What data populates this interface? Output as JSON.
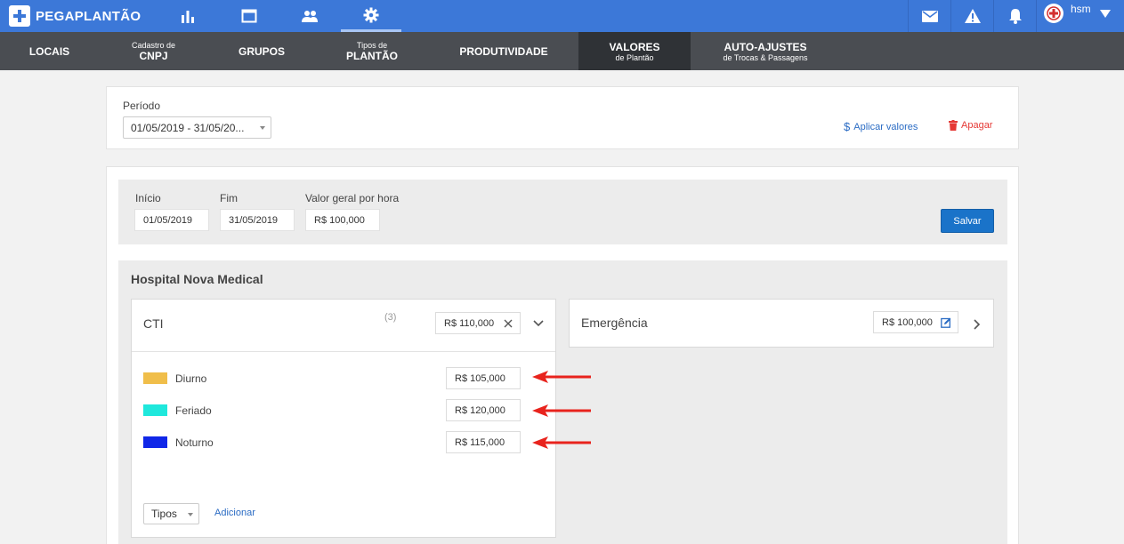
{
  "app": {
    "name": "PEGAPLANTÃO"
  },
  "top_nav": {
    "icons": [
      "bar-chart-icon",
      "window-icon",
      "people-icon",
      "gear-icon"
    ],
    "active": "gear-icon"
  },
  "top_right": {
    "icons": [
      "mail-icon",
      "warning-icon",
      "bell-icon"
    ],
    "user": "hsm"
  },
  "sub_nav": [
    {
      "small": "",
      "main": "LOCAIS"
    },
    {
      "small": "Cadastro de",
      "main": "CNPJ"
    },
    {
      "small": "",
      "main": "GRUPOS"
    },
    {
      "small": "Tipos de",
      "main": "PLANTÃO"
    },
    {
      "small": "",
      "main": "PRODUTIVIDADE"
    },
    {
      "main": "VALORES",
      "small_below": "de Plantão",
      "active": true
    },
    {
      "main": "AUTO-AJUSTES",
      "small_below": "de Trocas & Passagens"
    }
  ],
  "period": {
    "label": "Período",
    "value": "01/05/2019 - 31/05/20...",
    "apply_label": "Aplicar valores",
    "delete_label": "Apagar"
  },
  "form": {
    "start_label": "Início",
    "start_value": "01/05/2019",
    "end_label": "Fim",
    "end_value": "31/05/2019",
    "general_label": "Valor geral por hora",
    "general_value": "R$ 100,000",
    "save_label": "Salvar"
  },
  "hospital": {
    "name": "Hospital Nova Medical",
    "sectors": [
      {
        "name": "CTI",
        "count": "(3)",
        "value": "R$ 110,000",
        "types": [
          {
            "label": "Diurno",
            "color": "#f0be4a",
            "value": "R$ 105,000"
          },
          {
            "label": "Feriado",
            "color": "#1fe8dc",
            "value": "R$ 120,000"
          },
          {
            "label": "Noturno",
            "color": "#1027e8",
            "value": "R$ 115,000"
          }
        ],
        "types_select": "Tipos",
        "add_label": "Adicionar"
      },
      {
        "name": "Emergência",
        "value": "R$ 100,000"
      }
    ]
  },
  "colors": {
    "primary": "#3c78d8",
    "subnav": "#4a4d52",
    "danger": "#e53935",
    "arrow": "#e8231d"
  }
}
